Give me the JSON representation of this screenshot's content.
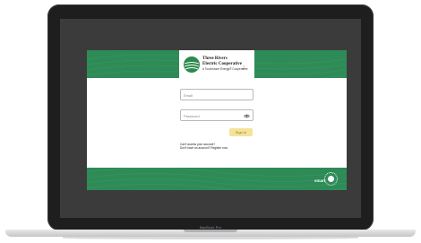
{
  "laptop": {
    "model_label": "MacBook Pro"
  },
  "logo": {
    "line1": "Three Rivers",
    "line2": "Electric Cooperative",
    "tagline": "A Touchstone Energy® Cooperative"
  },
  "form": {
    "email_placeholder": "Email",
    "password_placeholder": "Password",
    "signin_label": "Sign In"
  },
  "links": {
    "cant_access": "Can't access your account?",
    "no_account": "Don't have an account? Register now."
  },
  "branding": {
    "smarthub_label": "smart"
  },
  "colors": {
    "brand_green": "#2e8b57",
    "signin_bg": "#f6e39a"
  }
}
